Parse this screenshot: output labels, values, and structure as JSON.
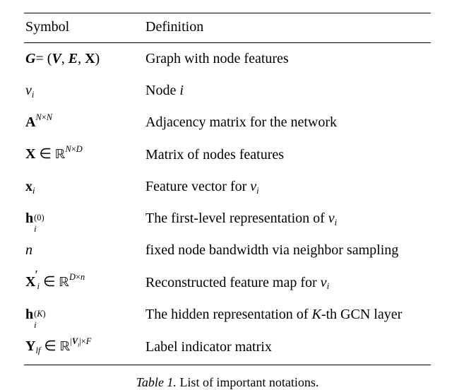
{
  "header": {
    "symbol_label": "Symbol",
    "definition_label": "Definition"
  },
  "rows": [
    {
      "symbol_html": "<span class='bi'>G</span><span class='rm'>= (</span><span class='bi'>V</span><span class='rm'>, </span><span class='bi'>E</span><span class='rm'>, </span><span class='bold'>X</span><span class='rm'>)</span>",
      "definition": "Graph with node features"
    },
    {
      "symbol_html": "<span class='mi'>v</span><span class='sub mi'>i</span>",
      "definition_html": "Node <span class='mi'>i</span>"
    },
    {
      "symbol_html": "<span class='bold'>A</span><span class='sup'><span class='mi'>N</span><span class='rm'>×</span><span class='mi'>N</span></span>",
      "definition": "Adjacency matrix for the network"
    },
    {
      "symbol_html": "<span class='bold'>X</span> <span class='rm'>∈</span> <span class='dsR rm'>ℝ</span><span class='sup'><span class='mi'>N</span><span class='rm'>×</span><span class='mi'>D</span></span>",
      "definition": "Matrix of nodes features"
    },
    {
      "symbol_html": "<span class='bold'>x</span><span class='sub mi'>i</span>",
      "definition_html": "Feature vector for <span class='mi'>v</span><span class='sub mi'>i</span>"
    },
    {
      "symbol_html": "<span class='bold'>h</span><span class='stack'><span class='st-sup rm'>(0)</span><span class='st-sub mi'>i</span></span><span class='stack-spacer' style='width:1.6em'></span>",
      "definition_html": "The first-level representation of <span class='mi'>v</span><span class='sub mi'>i</span>"
    },
    {
      "symbol_html": "<span class='mi'>n</span>",
      "definition": "fixed node bandwidth via neighbor sampling"
    },
    {
      "symbol_html": "<span class='bold'>X</span><span class='rm' style='position:relative; top:-0.55em; left:-0.05em; font-size:0.9em'>′</span><span class='sub mi' style='margin-left:-0.15em'>i</span> <span class='rm'>∈</span> <span class='dsR rm'>ℝ</span><span class='sup'><span class='mi'>D</span><span class='rm'>×</span><span class='mi'>n</span></span>",
      "definition_html": "Reconstructed feature map for <span class='mi'>v</span><span class='sub mi'>i</span>"
    },
    {
      "symbol_html": "<span class='bold'>h</span><span class='stack'><span class='st-sup rm'>(<span class=\"mi\">K</span>)</span><span class='st-sub mi'>i</span></span><span class='stack-spacer' style='width:2.0em'></span>",
      "definition_html": "The hidden representation of <span class='mi'>K</span>-th GCN layer"
    },
    {
      "symbol_html": "<span class='bold'>Y</span><span class='sub mi'>lf</span> <span class='rm'>∈</span> <span class='dsR rm'>ℝ</span><span class='sup'><span class='rm'>|</span><span class='bi'>V</span><span class='sub mi' style='top:0.5em'>l</span><span class='rm'>|×</span><span class='mi'>F</span></span>",
      "definition": "Label indicator matrix"
    }
  ],
  "caption": {
    "label": "Table 1.",
    "text": "List of important notations."
  }
}
